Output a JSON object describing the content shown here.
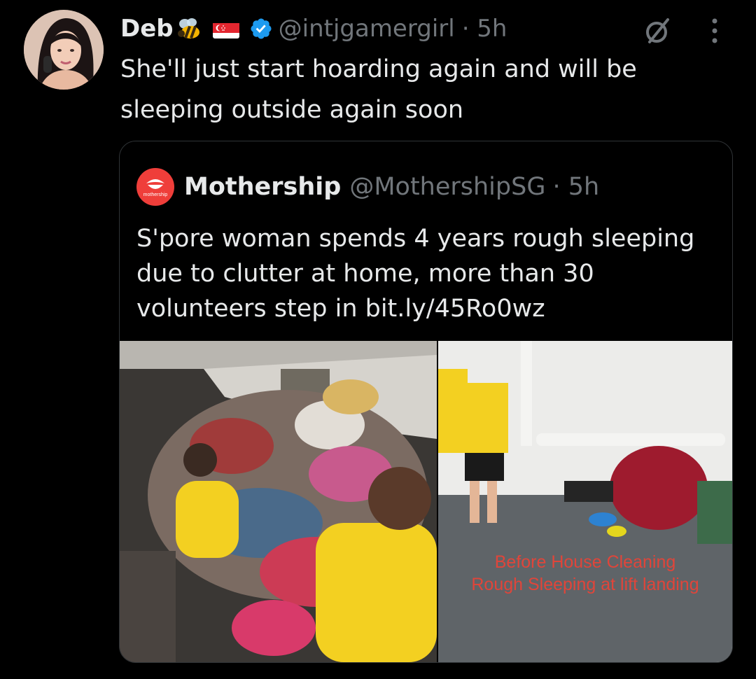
{
  "tweet": {
    "name": "Deb",
    "handle": "@intjgamergirl",
    "time": "· 5h",
    "text": "She'll just start hoarding again and will be sleeping outside again soon",
    "icons": [
      "bee-icon",
      "singapore-flag-icon",
      "verified-badge-icon",
      "grok-icon",
      "more-icon"
    ]
  },
  "quote": {
    "logo_text": "mothership",
    "name": "Mothership",
    "handle": "@MothershipSG",
    "time": "· 5h",
    "text": "S'pore woman spends 4 years rough sleeping due to clutter at home, more than 30 volunteers step in bit.ly/45Ro0wz",
    "caption_line1": "Before House Cleaning",
    "caption_line2": "Rough Sleeping at lift landing"
  },
  "colors": {
    "background": "#000000",
    "text": "#e7e9ea",
    "secondary": "#71767b",
    "verified": "#1d9bf0",
    "logo": "#ef3e3a",
    "caption": "#e0453a"
  }
}
